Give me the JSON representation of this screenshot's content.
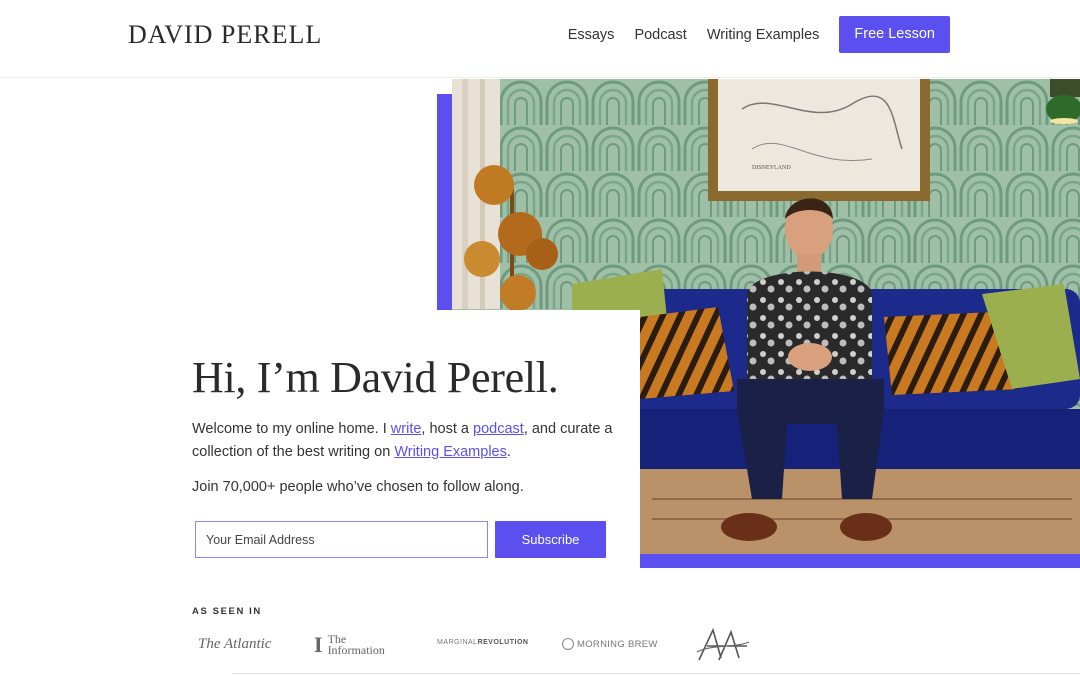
{
  "header": {
    "logo": "DAVID PERELL",
    "nav": [
      {
        "label": "Essays"
      },
      {
        "label": "Podcast"
      },
      {
        "label": "Writing Examples"
      }
    ],
    "cta": "Free Lesson"
  },
  "hero": {
    "title": "Hi, I’m David Perell.",
    "intro": {
      "p1": "Welcome to my online home. I ",
      "link_write": "write",
      "p2": ", host a ",
      "link_podcast": "podcast",
      "p3": ", and curate a collection of the best writing on ",
      "link_examples": "Writing Examples",
      "p4": "."
    },
    "join": "Join 70,000+ people who’ve chosen to follow along.",
    "email_placeholder": "Your Email Address",
    "subscribe": "Subscribe",
    "photo_sign": "DISNEYLAND"
  },
  "as_seen_in": {
    "label": "AS SEEN IN",
    "publications": {
      "atlantic": "The Atlantic",
      "info_mark": "I",
      "info_line1": "The",
      "info_line2": "Information",
      "mr_a": "MARGINAL",
      "mr_b": "REVOLUTION",
      "brew": "MORNING BREW"
    }
  },
  "colors": {
    "accent": "#5b4ff0",
    "text": "#2b2b2b",
    "sofa": "#1c2a8c"
  },
  "icons": [
    "signature-logo-icon",
    "morning-brew-icon"
  ]
}
